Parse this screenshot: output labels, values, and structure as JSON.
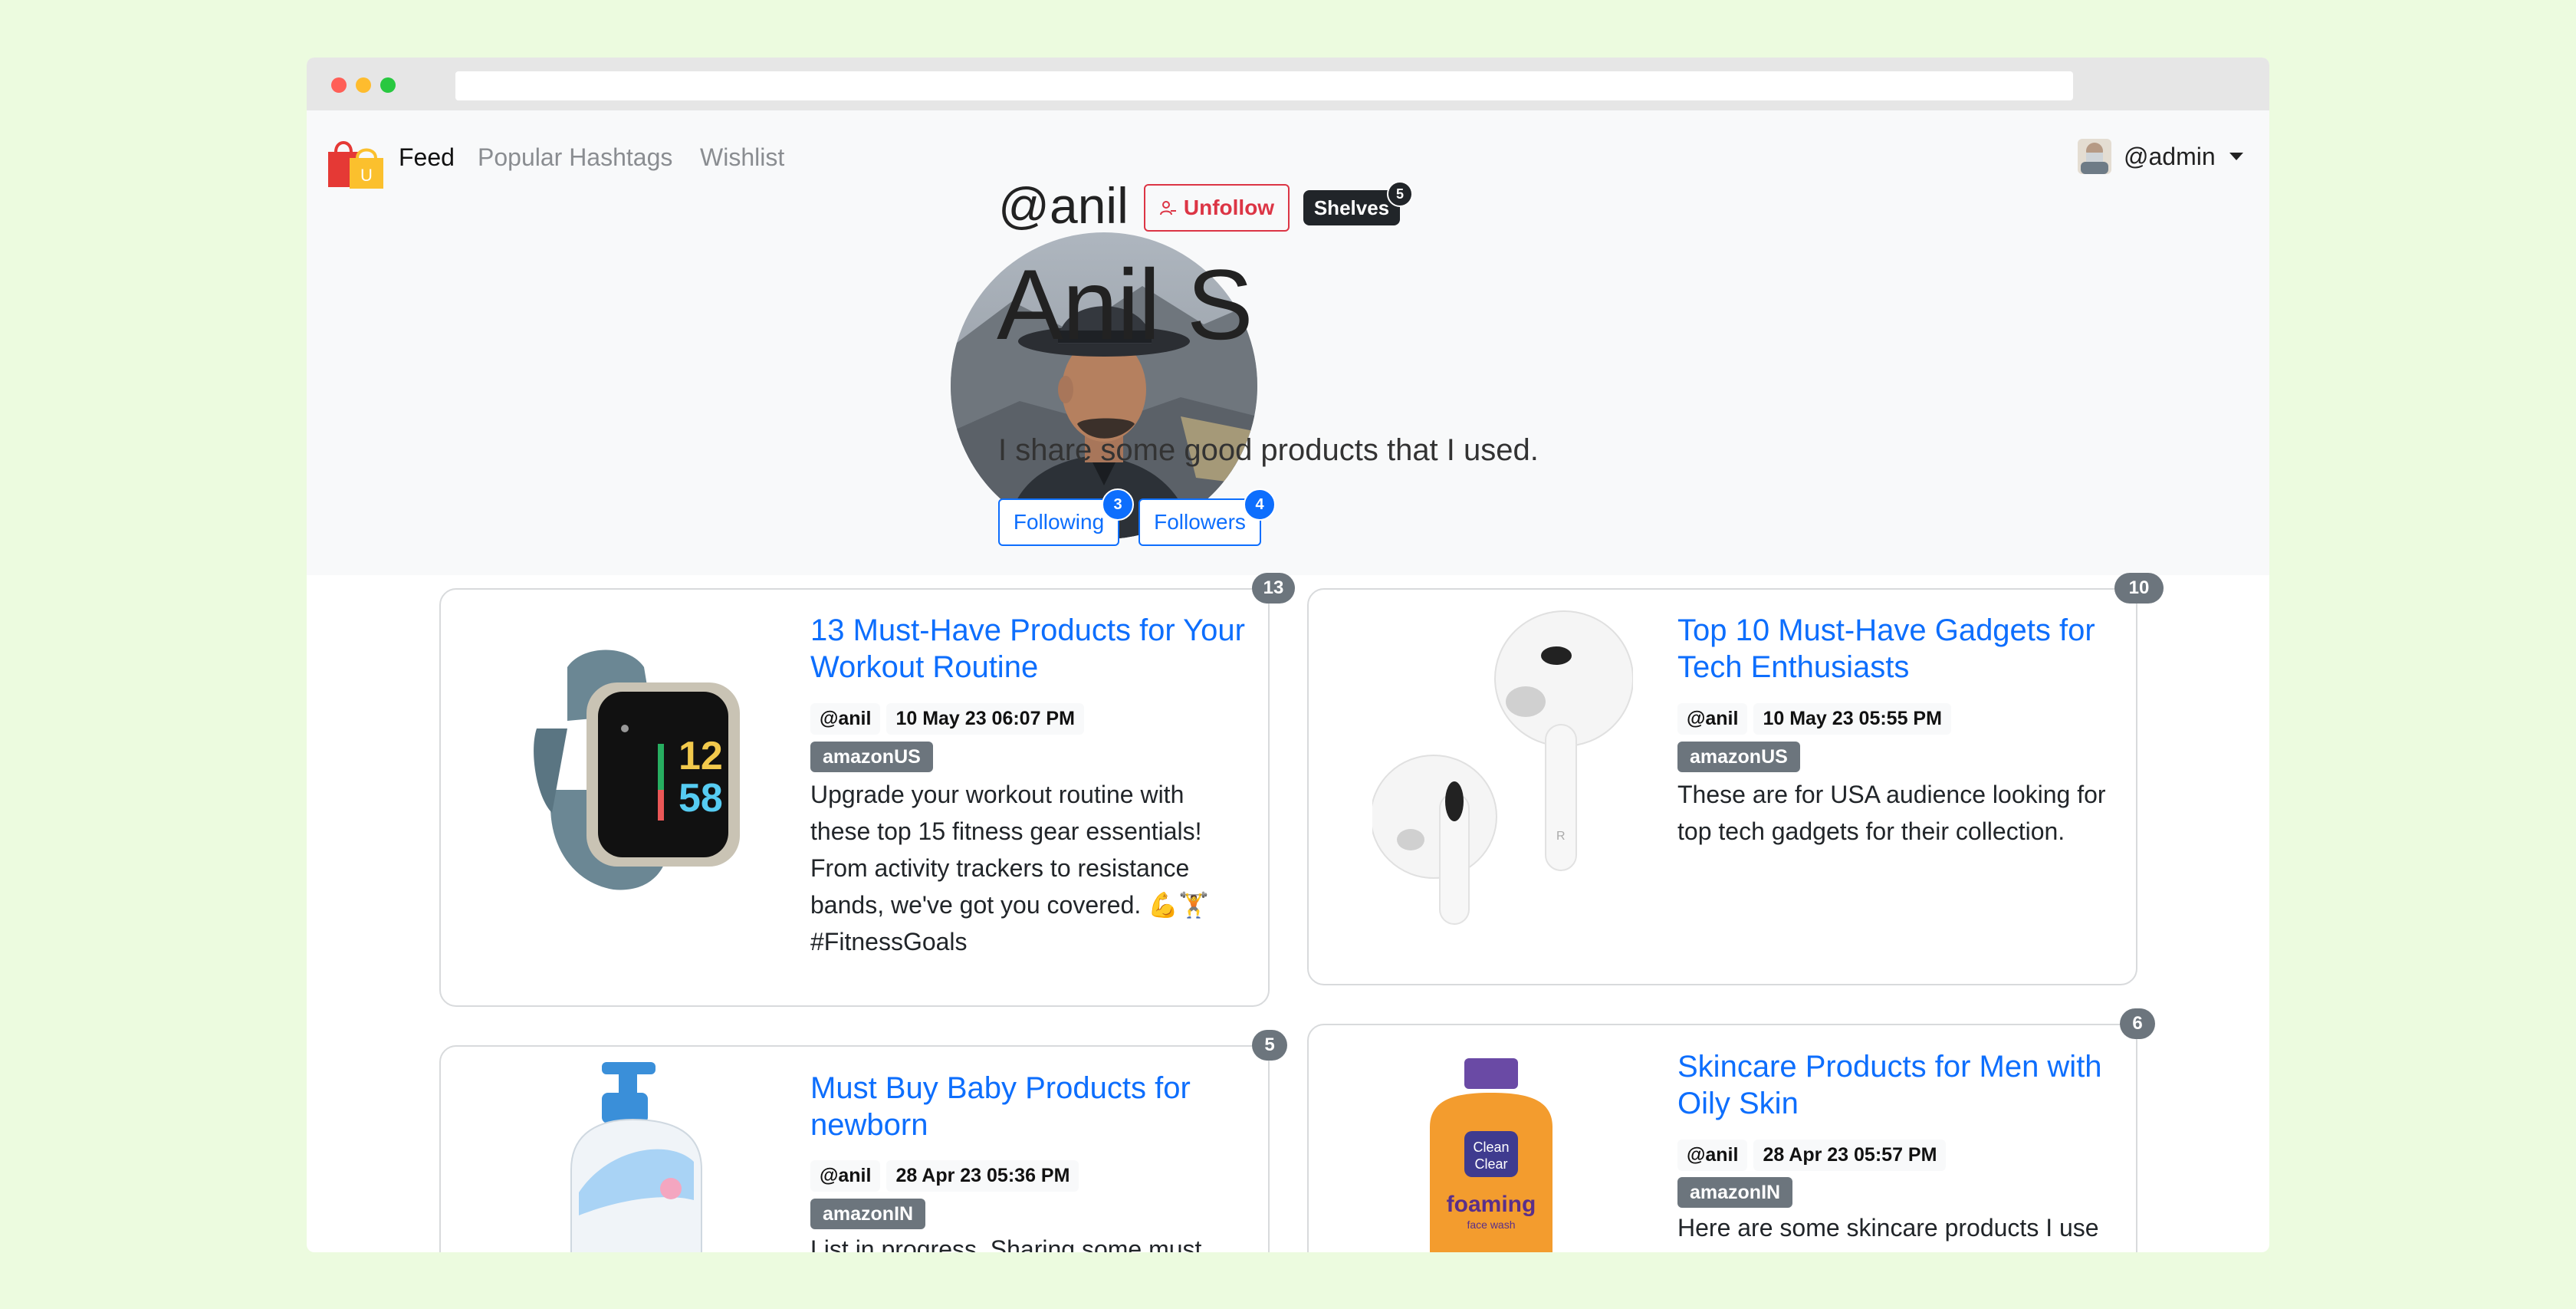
{
  "nav": {
    "links": [
      "Feed",
      "Popular Hashtags",
      "Wishlist"
    ],
    "user": "@admin"
  },
  "profile": {
    "handle": "@anil",
    "unfollow_label": "Unfollow",
    "shelves_label": "Shelves",
    "shelves_count": "5",
    "name": "Anil S",
    "bio": "I share some good products that I used.",
    "following_label": "Following",
    "following_count": "3",
    "followers_label": "Followers",
    "followers_count": "4"
  },
  "cards": [
    {
      "count": "13",
      "title": "13 Must-Have Products for Your Workout Routine",
      "author": "@anil",
      "date": "10 May 23 06:07 PM",
      "store": "amazonUS",
      "description": "Upgrade your workout routine with these top 15 fitness gear essentials! From activity trackers to resistance bands, we've got you covered. 💪🏋 #FitnessGoals"
    },
    {
      "count": "10",
      "title": "Top 10 Must-Have Gadgets for Tech Enthusiasts",
      "author": "@anil",
      "date": "10 May 23 05:55 PM",
      "store": "amazonUS",
      "description": "These are for USA audience looking for top tech gadgets for their collection."
    },
    {
      "count": "5",
      "title": "Must Buy Baby Products for newborn",
      "author": "@anil",
      "date": "28 Apr 23 05:36 PM",
      "store": "amazonIN",
      "description": "List in progress. Sharing some must"
    },
    {
      "count": "6",
      "title": "Skincare Products for Men with Oily Skin",
      "author": "@anil",
      "date": "28 Apr 23 05:57 PM",
      "store": "amazonIN",
      "description": "Here are some skincare products I use"
    }
  ],
  "colors": {
    "background": "#ecfbdf",
    "primary": "#0d6efd",
    "danger": "#dc3545",
    "dark": "#212529",
    "secondary": "#6c757d"
  }
}
